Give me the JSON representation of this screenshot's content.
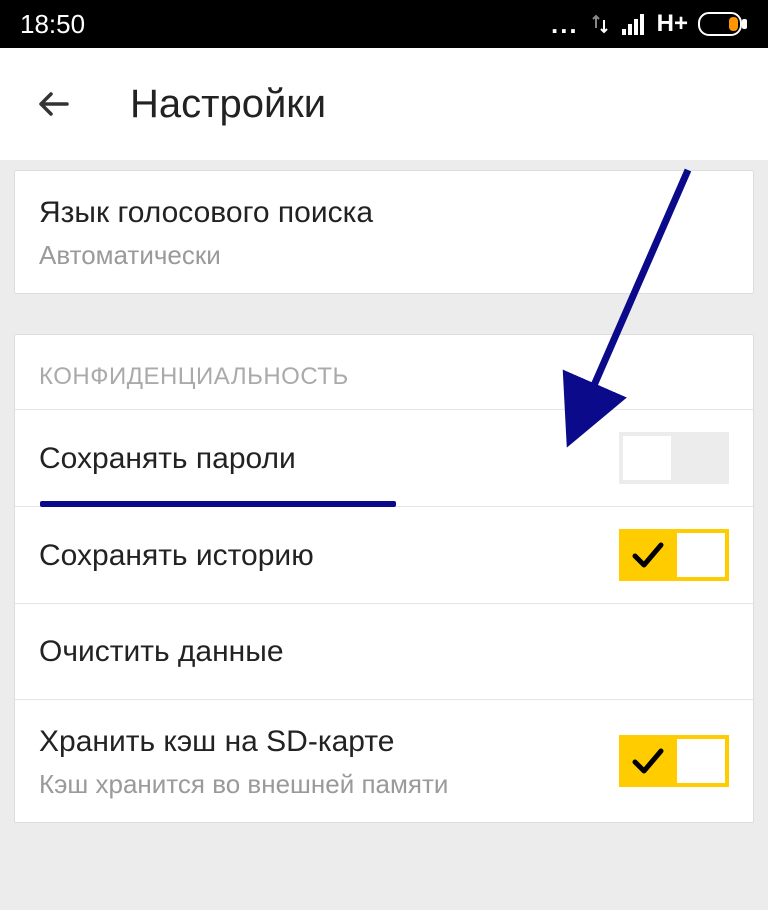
{
  "status": {
    "time": "18:50",
    "network": "H+"
  },
  "header": {
    "title": "Настройки"
  },
  "voice": {
    "title": "Язык голосового поиска",
    "value": "Автоматически"
  },
  "privacy": {
    "header": "КОНФИДЕНЦИАЛЬНОСТЬ",
    "save_passwords": "Сохранять пароли",
    "save_history": "Сохранять историю",
    "clear_data": "Очистить данные",
    "cache_sd": "Хранить кэш на SD-карте",
    "cache_sd_sub": "Кэш хранится во внешней памяти",
    "toggle_save_passwords": false,
    "toggle_save_history": true,
    "toggle_cache_sd": true
  },
  "annotation": {
    "arrow_color": "#0a0a8a",
    "underline_color": "#0a0a8a"
  }
}
